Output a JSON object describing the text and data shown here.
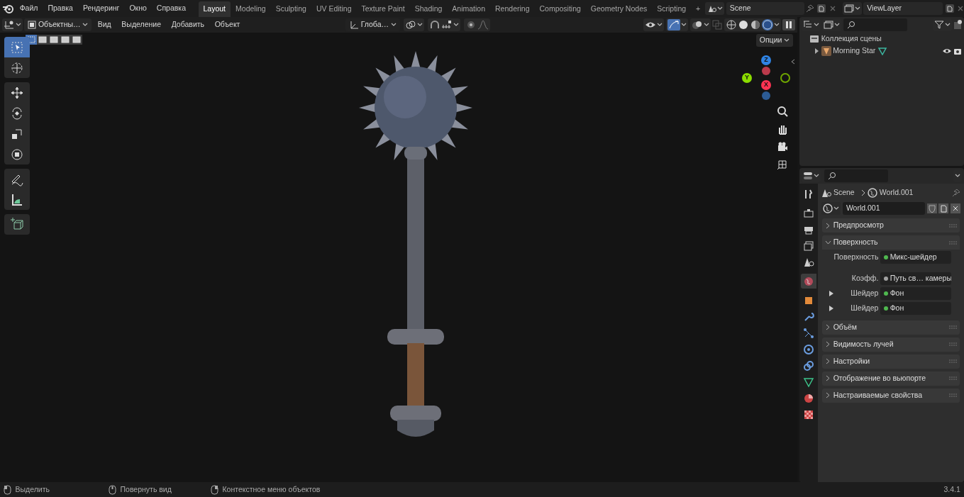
{
  "menu": [
    "Файл",
    "Правка",
    "Рендеринг",
    "Окно",
    "Справка"
  ],
  "workspaces": [
    {
      "label": "Layout",
      "selected": true
    },
    {
      "label": "Modeling",
      "selected": false
    },
    {
      "label": "Sculpting",
      "selected": false
    },
    {
      "label": "UV Editing",
      "selected": false
    },
    {
      "label": "Texture Paint",
      "selected": false
    },
    {
      "label": "Shading",
      "selected": false
    },
    {
      "label": "Animation",
      "selected": false
    },
    {
      "label": "Rendering",
      "selected": false
    },
    {
      "label": "Compositing",
      "selected": false
    },
    {
      "label": "Geometry Nodes",
      "selected": false
    },
    {
      "label": "Scripting",
      "selected": false
    }
  ],
  "add_workspace": "+",
  "scene": "Scene",
  "view_layer": "ViewLayer",
  "viewport_header": {
    "mode": "Объектны…",
    "menus": [
      "Вид",
      "Выделение",
      "Добавить",
      "Объект"
    ],
    "orientation": "Глоба…",
    "options": "Опции"
  },
  "select_modes": [
    {
      "selected": true
    },
    {
      "selected": false
    },
    {
      "selected": false
    },
    {
      "selected": false
    },
    {
      "selected": false
    }
  ],
  "shading_modes": [
    {
      "kind": "wire",
      "selected": false
    },
    {
      "kind": "solid",
      "selected": false
    },
    {
      "kind": "material",
      "selected": false
    },
    {
      "kind": "rendered",
      "selected": true
    }
  ],
  "tool_groups": [
    [
      {
        "kind": "select",
        "selected": true
      },
      {
        "kind": "cursor",
        "selected": false
      }
    ],
    [
      {
        "kind": "move",
        "selected": false
      },
      {
        "kind": "rotate",
        "selected": false
      },
      {
        "kind": "scale",
        "selected": false
      },
      {
        "kind": "transform",
        "selected": false
      }
    ],
    [
      {
        "kind": "annotate",
        "selected": false
      },
      {
        "kind": "measure",
        "selected": false
      }
    ],
    [
      {
        "kind": "add-cube",
        "selected": false
      }
    ]
  ],
  "gizmo": {
    "axes": [
      {
        "label": "Z",
        "color": "#2f83e3"
      },
      {
        "label": "Y",
        "color": "#8bdc00"
      },
      {
        "label": "X",
        "color": "#ff3352"
      }
    ]
  },
  "outliner": {
    "collection": "Коллекция сцены",
    "object": "Morning Star",
    "object_expanded": false
  },
  "properties": {
    "breadcrumb": [
      "Scene",
      "World.001"
    ],
    "datablock": "World.001",
    "tabs": [
      {
        "kind": "tool",
        "selected": false
      },
      {
        "kind": "render",
        "selected": false
      },
      {
        "kind": "output",
        "selected": false
      },
      {
        "kind": "view-layer",
        "selected": false
      },
      {
        "kind": "scene",
        "selected": false
      },
      {
        "kind": "world",
        "selected": true
      },
      {
        "kind": "object",
        "selected": false
      },
      {
        "kind": "modifier",
        "selected": false
      },
      {
        "kind": "particles",
        "selected": false
      },
      {
        "kind": "physics",
        "selected": false
      },
      {
        "kind": "constraints",
        "selected": false
      },
      {
        "kind": "data",
        "selected": false
      },
      {
        "kind": "material",
        "selected": false
      },
      {
        "kind": "texture",
        "selected": false
      }
    ],
    "panels": [
      {
        "label": "Предпросмотр",
        "expanded": false
      },
      {
        "label": "Поверхность",
        "expanded": true,
        "rows": [
          {
            "kind": "value",
            "label": "Поверхность",
            "value": "Микс-шейдер",
            "color": "#4fb84f"
          },
          {
            "kind": "value",
            "label": "Коэфф.",
            "value": "Путь св… камеры",
            "color": "#a1a1a1"
          },
          {
            "kind": "shader",
            "label": "Шейдер",
            "value": "Фон",
            "color": "#4fb84f"
          },
          {
            "kind": "shader",
            "label": "Шейдер",
            "value": "Фон",
            "color": "#4fb84f"
          }
        ]
      },
      {
        "label": "Объём",
        "expanded": false
      },
      {
        "label": "Видимость лучей",
        "expanded": false
      },
      {
        "label": "Настройки",
        "expanded": false
      },
      {
        "label": "Отображение во вьюпорте",
        "expanded": false
      },
      {
        "label": "Настраиваемые свойства",
        "expanded": false
      }
    ]
  },
  "status_bar": {
    "hints": [
      "Выделить",
      "Повернуть вид",
      "Контекстное меню объектов"
    ],
    "version": "3.4.1"
  }
}
